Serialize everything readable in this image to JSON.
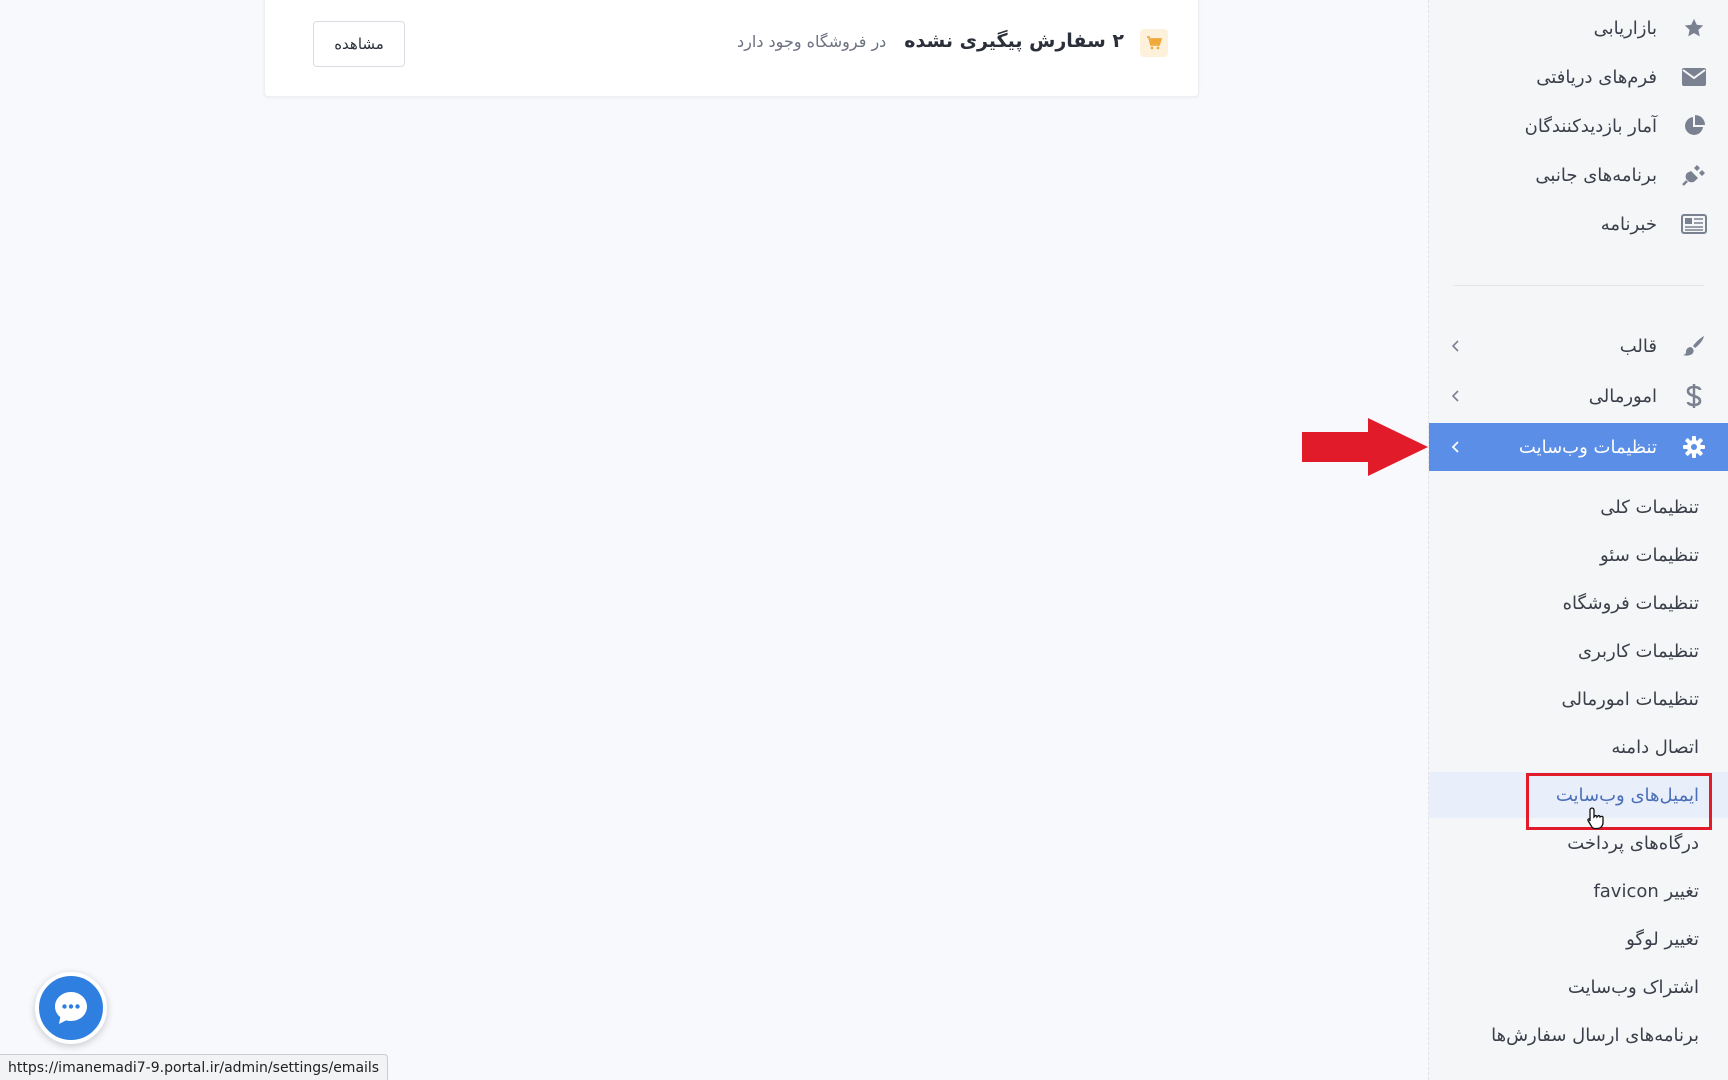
{
  "notice": {
    "orders_text": "۲ سفارش پیگیری نشده",
    "store_text": "در فروشگاه وجود دارد",
    "view_button": "مشاهده",
    "icon": "cart-icon"
  },
  "sidebar": {
    "top_items": [
      {
        "label": "بازاریابی",
        "icon": "star-icon"
      },
      {
        "label": "فرم‌های دریافتی",
        "icon": "envelope-icon"
      },
      {
        "label": "آمار بازدیدکنندگان",
        "icon": "pie-chart-icon"
      },
      {
        "label": "برنامه‌های جانبی",
        "icon": "plug-icon"
      },
      {
        "label": "خبرنامه",
        "icon": "newspaper-icon"
      }
    ],
    "group_items": [
      {
        "label": "قالب",
        "icon": "brush-icon"
      },
      {
        "label": "امورمالی",
        "icon": "dollar-icon"
      },
      {
        "label": "تنظیمات وب‌سایت",
        "icon": "gear-icon",
        "active": true
      }
    ],
    "sub_items": [
      {
        "label": "تنظیمات کلی"
      },
      {
        "label": "تنظیمات سئو"
      },
      {
        "label": "تنظیمات فروشگاه"
      },
      {
        "label": "تنظیمات کاربری"
      },
      {
        "label": "تنظیمات امورمالی"
      },
      {
        "label": "اتصال دامنه"
      },
      {
        "label": "ایمیل‌های وب‌سایت",
        "highlighted": true
      },
      {
        "label": "درگاه‌های پرداخت"
      },
      {
        "label": "تغییر favicon"
      },
      {
        "label": "تغییر لوگو"
      },
      {
        "label": "اشتراک وب‌سایت"
      },
      {
        "label": "برنامه‌های ارسال سفارش‌ها"
      }
    ]
  },
  "status_bar": {
    "url": "https://imanemadi7-9.portal.ir/admin/settings/emails"
  },
  "colors": {
    "active_bg": "#5b8ee6",
    "highlight_bg": "#e9eefb",
    "annotation": "#e21b2b",
    "chat": "#2f7fe0"
  }
}
